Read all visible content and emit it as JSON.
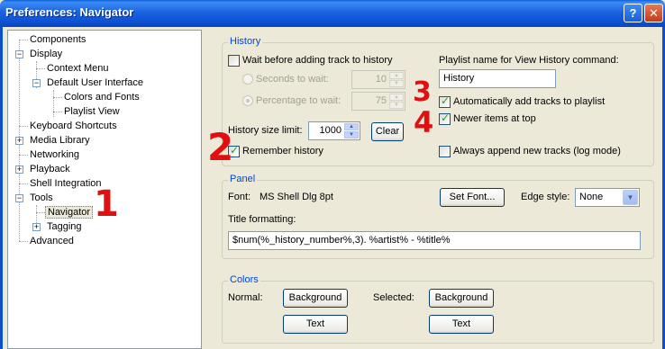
{
  "window": {
    "title": "Preferences: Navigator",
    "help_glyph": "?",
    "close_glyph": "✕"
  },
  "tree": {
    "items": [
      {
        "label": "Components"
      },
      {
        "label": "Display"
      },
      {
        "label": "Context Menu"
      },
      {
        "label": "Default User Interface"
      },
      {
        "label": "Colors and Fonts"
      },
      {
        "label": "Playlist View"
      },
      {
        "label": "Keyboard Shortcuts"
      },
      {
        "label": "Media Library"
      },
      {
        "label": "Networking"
      },
      {
        "label": "Playback"
      },
      {
        "label": "Shell Integration"
      },
      {
        "label": "Tools"
      },
      {
        "label": "Navigator"
      },
      {
        "label": "Tagging"
      },
      {
        "label": "Advanced"
      }
    ],
    "minus": "−",
    "plus": "+"
  },
  "history": {
    "title": "History",
    "wait_label": "Wait before adding track to history",
    "seconds_label": "Seconds to wait:",
    "seconds_value": "10",
    "percentage_label": "Percentage to wait:",
    "percentage_value": "75",
    "size_limit_label": "History size limit:",
    "size_limit_value": "1000",
    "clear_button": "Clear",
    "remember_label": "Remember history",
    "playlist_name_label": "Playlist name for View History command:",
    "playlist_name_value": "History",
    "auto_add_label": "Automatically add tracks to playlist",
    "newer_top_label": "Newer items at top",
    "always_append_label": "Always append new tracks (log mode)"
  },
  "panel": {
    "title": "Panel",
    "font_label": "Font:",
    "font_value": "MS Shell Dlg 8pt",
    "set_font_button": "Set Font...",
    "edge_style_label": "Edge style:",
    "edge_style_value": "None",
    "title_formatting_label": "Title formatting:",
    "title_formatting_value": "$num(%_history_number%,3). %artist% - %title%"
  },
  "colors": {
    "title": "Colors",
    "normal_label": "Normal:",
    "selected_label": "Selected:",
    "background_button": "Background",
    "text_button": "Text"
  },
  "annotations": {
    "one": "1",
    "two": "2",
    "three": "3",
    "four": "4"
  },
  "glyphs": {
    "up": "▲",
    "down": "▼"
  },
  "accent_colors": {
    "title_bar": "#0b4fd0",
    "group_title": "#0046d5",
    "annotation": "#e01010"
  }
}
